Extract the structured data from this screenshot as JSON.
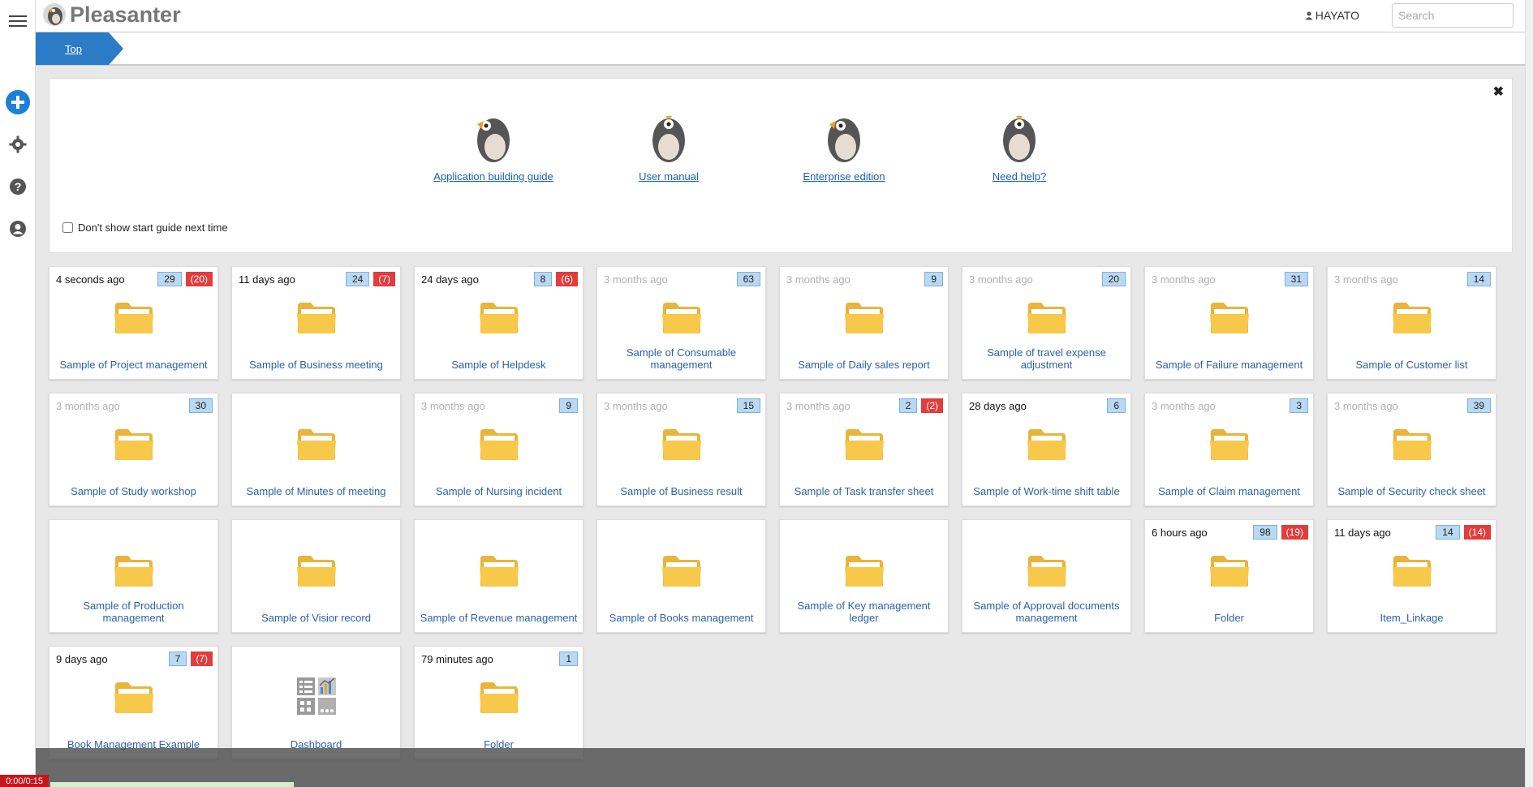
{
  "app": {
    "title": "Pleasanter"
  },
  "header": {
    "user": "HAYATO",
    "search_placeholder": "Search"
  },
  "breadcrumb": {
    "top": "Top"
  },
  "guide": {
    "items": [
      "Application building guide",
      "User manual",
      "Enterprise edition",
      "Need help?"
    ],
    "checkbox_label": "Don't show start guide next time",
    "close": "✖"
  },
  "tiles": [
    {
      "time": "4 seconds ago",
      "fresh": true,
      "count": "29",
      "over": "(20)",
      "title": "Sample of Project management",
      "icon": "folder-icon"
    },
    {
      "time": "11 days ago",
      "fresh": true,
      "count": "24",
      "over": "(7)",
      "title": "Sample of Business meeting",
      "icon": "folder-icon"
    },
    {
      "time": "24 days ago",
      "fresh": true,
      "count": "8",
      "over": "(6)",
      "title": "Sample of Helpdesk",
      "icon": "folder-icon"
    },
    {
      "time": "3 months ago",
      "fresh": false,
      "count": "63",
      "over": "",
      "title": "Sample of Consumable management",
      "icon": "folder-icon"
    },
    {
      "time": "3 months ago",
      "fresh": false,
      "count": "9",
      "over": "",
      "title": "Sample of Daily sales report",
      "icon": "folder-icon"
    },
    {
      "time": "3 months ago",
      "fresh": false,
      "count": "20",
      "over": "",
      "title": "Sample of travel expense adjustment",
      "icon": "folder-icon"
    },
    {
      "time": "3 months ago",
      "fresh": false,
      "count": "31",
      "over": "",
      "title": "Sample of Failure management",
      "icon": "folder-icon"
    },
    {
      "time": "3 months ago",
      "fresh": false,
      "count": "14",
      "over": "",
      "title": "Sample of Customer list",
      "icon": "folder-icon"
    },
    {
      "time": "3 months ago",
      "fresh": false,
      "count": "30",
      "over": "",
      "title": "Sample of Study workshop",
      "icon": "folder-icon"
    },
    {
      "time": "",
      "fresh": false,
      "count": "",
      "over": "",
      "title": "Sample of Minutes of meeting",
      "icon": "folder-icon"
    },
    {
      "time": "3 months ago",
      "fresh": false,
      "count": "9",
      "over": "",
      "title": "Sample of Nursing incident",
      "icon": "folder-icon"
    },
    {
      "time": "3 months ago",
      "fresh": false,
      "count": "15",
      "over": "",
      "title": "Sample of Business result",
      "icon": "folder-icon"
    },
    {
      "time": "3 months ago",
      "fresh": false,
      "count": "2",
      "over": "(2)",
      "title": "Sample of Task transfer sheet",
      "icon": "folder-icon"
    },
    {
      "time": "28 days ago",
      "fresh": true,
      "count": "6",
      "over": "",
      "title": "Sample of Work-time shift table",
      "icon": "folder-icon"
    },
    {
      "time": "3 months ago",
      "fresh": false,
      "count": "3",
      "over": "",
      "title": "Sample of Claim management",
      "icon": "folder-icon"
    },
    {
      "time": "3 months ago",
      "fresh": false,
      "count": "39",
      "over": "",
      "title": "Sample of Security check sheet",
      "icon": "folder-icon"
    },
    {
      "time": "",
      "fresh": false,
      "count": "",
      "over": "",
      "title": "Sample of Production management",
      "icon": "folder-icon"
    },
    {
      "time": "",
      "fresh": false,
      "count": "",
      "over": "",
      "title": "Sample of Visior record",
      "icon": "folder-icon"
    },
    {
      "time": "",
      "fresh": false,
      "count": "",
      "over": "",
      "title": "Sample of Revenue management",
      "icon": "folder-icon"
    },
    {
      "time": "",
      "fresh": false,
      "count": "",
      "over": "",
      "title": "Sample of Books management",
      "icon": "folder-icon"
    },
    {
      "time": "",
      "fresh": false,
      "count": "",
      "over": "",
      "title": "Sample of Key management ledger",
      "icon": "folder-icon"
    },
    {
      "time": "",
      "fresh": false,
      "count": "",
      "over": "",
      "title": "Sample of Approval documents management",
      "icon": "folder-icon"
    },
    {
      "time": "6 hours ago",
      "fresh": true,
      "count": "98",
      "over": "(19)",
      "title": "Folder",
      "icon": "folder-icon"
    },
    {
      "time": "11 days ago",
      "fresh": true,
      "count": "14",
      "over": "(14)",
      "title": "Item_Linkage",
      "icon": "folder-icon"
    },
    {
      "time": "9 days ago",
      "fresh": true,
      "count": "7",
      "over": "(7)",
      "title": "Book Management Example",
      "icon": "folder-icon"
    },
    {
      "time": "",
      "fresh": false,
      "count": "",
      "over": "",
      "title": "Dashboard",
      "icon": "dashboard-icon"
    },
    {
      "time": "79 minutes ago",
      "fresh": true,
      "count": "1",
      "over": "",
      "title": "Folder",
      "icon": "folder-icon"
    }
  ],
  "video": {
    "time": "0:00/0:15"
  },
  "colors": {
    "accent": "#2b7bc6",
    "badge_red": "#e23c3c",
    "badge_blue": "#b9d8f2",
    "folder": "#f8c84a"
  }
}
